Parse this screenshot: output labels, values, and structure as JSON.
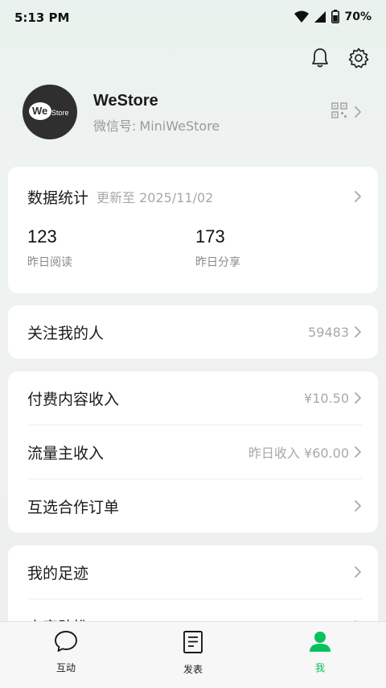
{
  "status_bar": {
    "time": "5:13 PM",
    "battery": "70%",
    "icons": [
      "wifi-icon",
      "signal-icon",
      "battery-icon"
    ]
  },
  "header": {
    "actions": [
      "bell-icon",
      "gear-icon"
    ]
  },
  "profile": {
    "avatar": {
      "text_we": "We",
      "text_store": "Store"
    },
    "name": "WeStore",
    "id_label": "微信号:",
    "id_value": "MiniWeStore"
  },
  "stats": {
    "title": "数据统计",
    "updated": "更新至 2025/11/02",
    "items": [
      {
        "value": "123",
        "label": "昨日阅读"
      },
      {
        "value": "173",
        "label": "昨日分享"
      }
    ]
  },
  "followers": {
    "label": "关注我的人",
    "value": "59483"
  },
  "income": {
    "rows": [
      {
        "label": "付费内容收入",
        "value": "¥10.50"
      },
      {
        "label": "流量主收入",
        "value": "昨日收入 ¥60.00"
      },
      {
        "label": "互选合作订单",
        "value": ""
      }
    ]
  },
  "more": {
    "rows": [
      {
        "label": "我的足迹"
      },
      {
        "label": "内容助推"
      }
    ]
  },
  "tab_bar": {
    "tabs": [
      {
        "label": "互动",
        "icon": "chat-bubble-icon",
        "active": false
      },
      {
        "label": "发表",
        "icon": "document-icon",
        "active": false
      },
      {
        "label": "我",
        "icon": "person-icon",
        "active": true
      }
    ]
  },
  "colors": {
    "accent": "#07c160",
    "background": "#eef2f0",
    "card": "#ffffff",
    "muted_text": "#a8a8a8"
  }
}
